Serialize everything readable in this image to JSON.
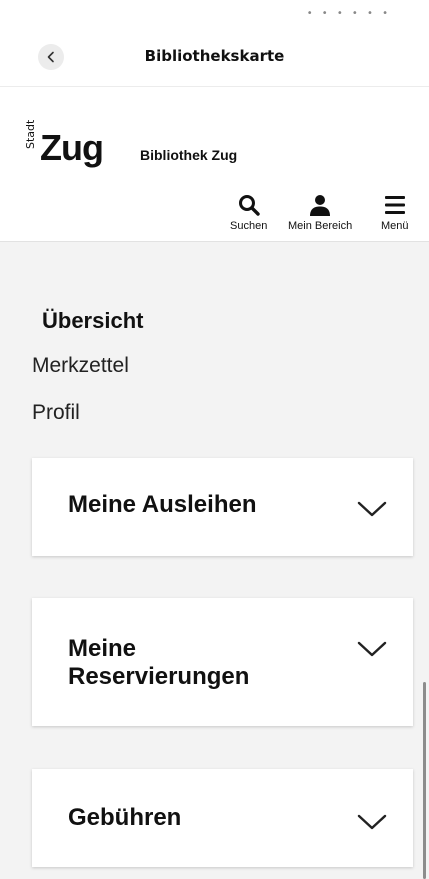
{
  "app_bar": {
    "title": "Bibliothekskarte",
    "back_icon": "chevron-left-icon"
  },
  "site_header": {
    "logo_small": "Stadt",
    "logo_big": "Zug",
    "library_name": "Bibliothek Zug",
    "nav": [
      {
        "label": "Suchen",
        "icon": "search-icon"
      },
      {
        "label": "Mein Bereich",
        "icon": "user-icon"
      },
      {
        "label": "Menü",
        "icon": "hamburger-menu-icon"
      }
    ]
  },
  "subnav": {
    "overview": "Übersicht",
    "notes": "Merkzettel",
    "profile": "Profil"
  },
  "cards": [
    {
      "title": "Meine Ausleihen",
      "icon": "chevron-down-icon"
    },
    {
      "title": "Meine Reservierungen",
      "icon": "chevron-down-icon"
    },
    {
      "title": "Gebühren",
      "icon": "chevron-down-icon"
    }
  ],
  "colors": {
    "background": "#f3f3f3",
    "card": "#ffffff",
    "text": "#111111"
  }
}
